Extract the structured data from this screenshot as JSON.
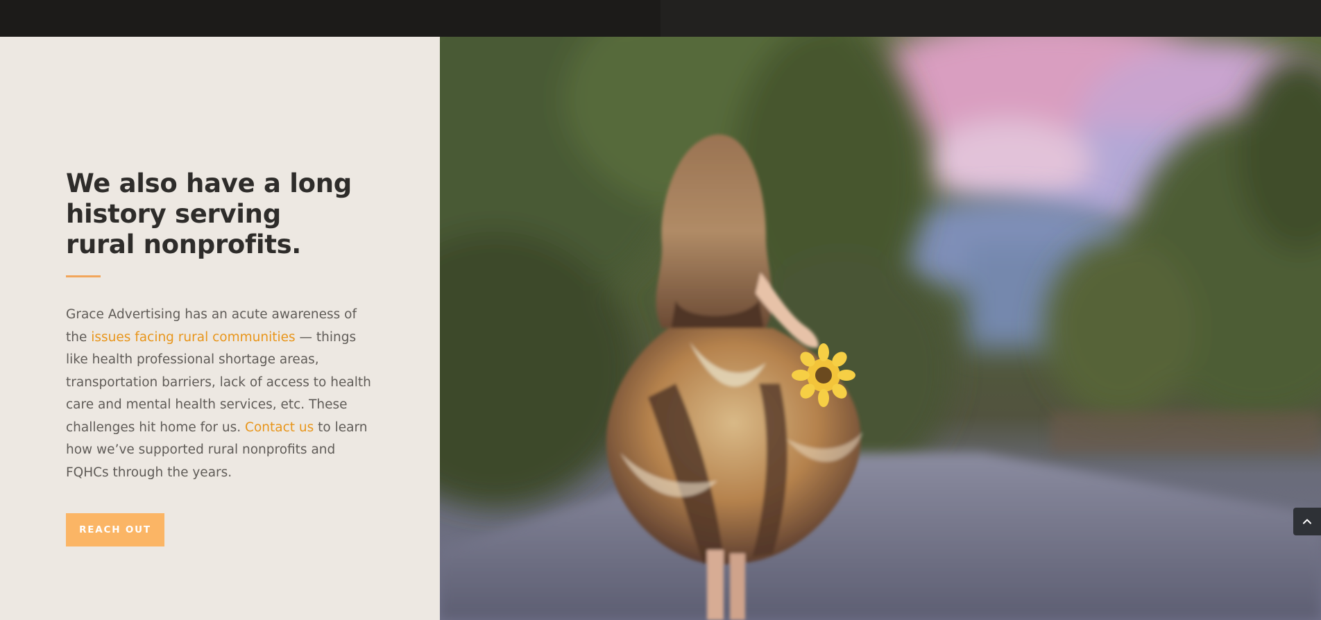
{
  "section": {
    "heading": "We also have a long history serving rural nonprofits.",
    "paragraph": {
      "part1": "Grace Advertising has an acute awareness of the ",
      "link1": "issues facing rural communities",
      "part2": " — things like health professional shortage areas, transportation barriers, lack of access to health care and mental health services, etc. These challenges hit home for us. ",
      "link2": "Contact us",
      "part3": " to learn how we’ve supported rural nonprofits and FQHCs through the years."
    },
    "cta_label": "REACH OUT"
  },
  "icons": {
    "scroll_top": "chevron-up-icon"
  },
  "colors": {
    "accent": "#f2a55a",
    "link": "#e8951a",
    "button": "#fbb565",
    "panel_bg": "#ede8e2",
    "header_bg": "#1c1b19"
  }
}
